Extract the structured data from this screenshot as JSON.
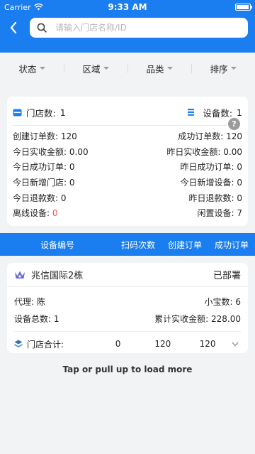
{
  "status_bar": {
    "carrier": "Carrier",
    "time": "9:33 AM"
  },
  "search": {
    "placeholder": "请输入门店名称/ID",
    "value": ""
  },
  "filters": [
    {
      "label": "状态"
    },
    {
      "label": "区域"
    },
    {
      "label": "品类"
    },
    {
      "label": "排序"
    }
  ],
  "summary": {
    "store_count_label": "门店数:",
    "store_count": "1",
    "device_count_label": "设备数:",
    "device_count": "1",
    "help_glyph": "?",
    "rows": [
      {
        "left_label": "创建订单数:",
        "left_value": "120",
        "right_label": "成功订单数:",
        "right_value": "120"
      },
      {
        "left_label": "今日实收金额:",
        "left_value": "0.00",
        "right_label": "昨日实收金额:",
        "right_value": "0.00"
      },
      {
        "left_label": "今日成功订单:",
        "left_value": "0",
        "right_label": "昨日成功订单:",
        "right_value": "0"
      },
      {
        "left_label": "今日新增门店:",
        "left_value": "0",
        "right_label": "今日新增设备:",
        "right_value": "0"
      },
      {
        "left_label": "今日退款数:",
        "left_value": "0",
        "right_label": "昨日退款数:",
        "right_value": "0"
      },
      {
        "left_label": "离线设备:",
        "left_value": "0",
        "right_label": "闲置设备:",
        "right_value": "7"
      }
    ]
  },
  "table_header": {
    "device_id": "设备编号",
    "scan_count": "扫码次数",
    "create_orders": "创建订单",
    "success_orders": "成功订单"
  },
  "store": {
    "name": "兆信国际2栋",
    "status": "已部署",
    "agent_label": "代理:",
    "agent_value": "陈",
    "xiaobao_label": "小宝数:",
    "xiaobao_value": "6",
    "devices_label": "设备总数:",
    "devices_value": "1",
    "revenue_label": "累计实收金额:",
    "revenue_value": "228.00",
    "totals_label": "门店合计:",
    "totals_scan": "0",
    "totals_create": "120",
    "totals_success": "120"
  },
  "load_more": "Tap or pull up to load more",
  "colors": {
    "accent": "#1b7ef0",
    "warn": "#e35a4a"
  }
}
